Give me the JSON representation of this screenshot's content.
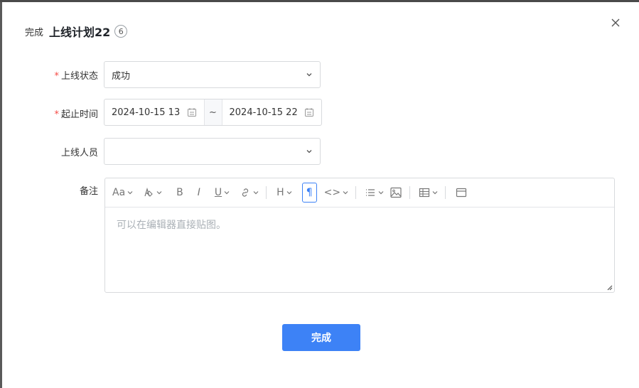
{
  "dialog": {
    "action_label": "完成",
    "title": "上线计划22",
    "badge": "6"
  },
  "form": {
    "status": {
      "label": "上线状态",
      "required_mark": "*",
      "value": "成功"
    },
    "time": {
      "label": "起止时间",
      "required_mark": "*",
      "start": "2024-10-15 13",
      "separator": "~",
      "end": "2024-10-15 22"
    },
    "people": {
      "label": "上线人员",
      "value": ""
    },
    "notes": {
      "label": "备注",
      "placeholder": "可以在编辑器直接贴图。"
    }
  },
  "toolbar": {
    "font_size_icon": "Aa",
    "bold": "B",
    "italic": "I",
    "underline": "U",
    "heading": "H",
    "paragraph": "¶",
    "code": "<>"
  },
  "footer": {
    "submit_label": "完成"
  },
  "colors": {
    "primary": "#3d82f6",
    "required": "#f54a45"
  }
}
